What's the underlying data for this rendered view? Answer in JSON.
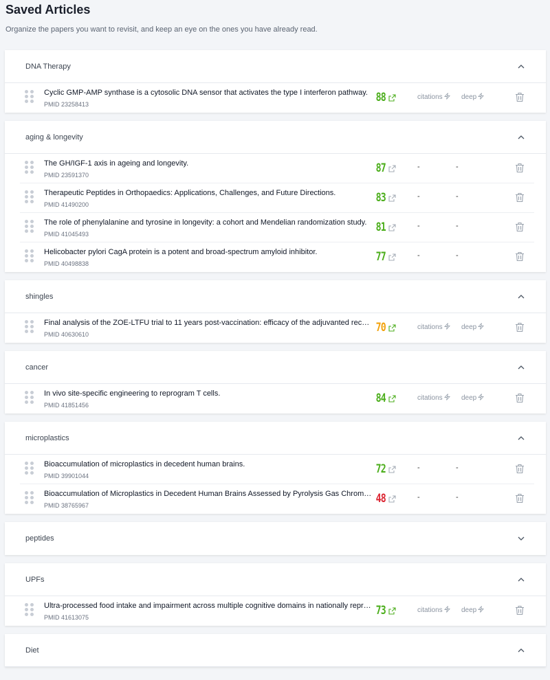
{
  "header": {
    "title": "Saved Articles",
    "subtitle": "Organize the papers you want to revisit, and keep an eye on the ones you have already read."
  },
  "colors": {
    "green": "#4cae1c",
    "orange": "#f2a20c",
    "red": "#dc2633"
  },
  "icons": {
    "drag": "drag-handle-icon",
    "external": "external-link-icon",
    "bolt": "bolt-icon",
    "trash": "trash-icon",
    "chevron": "chevron-icon"
  },
  "labels": {
    "citations": "citations",
    "deep": "deep",
    "dash": "-"
  },
  "folders": [
    {
      "name": "DNA Therapy",
      "expanded": true,
      "articles": [
        {
          "title": "Cyclic GMP-AMP synthase is a cytosolic DNA sensor that activates the type I interferon pathway.",
          "pmid": "PMID 23258413",
          "score": "88",
          "color": "green",
          "actions": true
        }
      ]
    },
    {
      "name": "aging & longevity",
      "expanded": true,
      "articles": [
        {
          "title": "The GH/IGF-1 axis in ageing and longevity.",
          "pmid": "PMID 23591370",
          "score": "87",
          "color": "green",
          "actions": false
        },
        {
          "title": "Therapeutic Peptides in Orthopaedics: Applications, Challenges, and Future Directions.",
          "pmid": "PMID 41490200",
          "score": "83",
          "color": "green",
          "actions": false
        },
        {
          "title": "The role of phenylalanine and tyrosine in longevity: a cohort and Mendelian randomization study.",
          "pmid": "PMID 41045493",
          "score": "81",
          "color": "green",
          "actions": false
        },
        {
          "title": "Helicobacter pylori CagA protein is a potent and broad-spectrum amyloid inhibitor.",
          "pmid": "PMID 40498838",
          "score": "77",
          "color": "green",
          "actions": false
        }
      ]
    },
    {
      "name": "shingles",
      "expanded": true,
      "articles": [
        {
          "title": "Final analysis of the ZOE-LTFU trial to 11 years post-vaccination: efficacy of the adjuvanted recomb…",
          "pmid": "PMID 40630610",
          "score": "70",
          "color": "orange",
          "actions": true
        }
      ]
    },
    {
      "name": "cancer",
      "expanded": true,
      "articles": [
        {
          "title": "In vivo site-specific engineering to reprogram T cells.",
          "pmid": "PMID 41851456",
          "score": "84",
          "color": "green",
          "actions": true
        }
      ]
    },
    {
      "name": "microplastics",
      "expanded": true,
      "articles": [
        {
          "title": "Bioaccumulation of microplastics in decedent human brains.",
          "pmid": "PMID 39901044",
          "score": "72",
          "color": "green",
          "actions": false
        },
        {
          "title": "Bioaccumulation of Microplastics in Decedent Human Brains Assessed by Pyrolysis Gas Chromat…",
          "pmid": "PMID 38765967",
          "score": "48",
          "color": "red",
          "actions": false
        }
      ]
    },
    {
      "name": "peptides",
      "expanded": false,
      "articles": []
    },
    {
      "name": "UPFs",
      "expanded": true,
      "articles": [
        {
          "title": "Ultra-processed food intake and impairment across multiple cognitive domains in nationally repre…",
          "pmid": "PMID 41613075",
          "score": "73",
          "color": "green",
          "actions": true
        }
      ]
    },
    {
      "name": "Diet",
      "expanded": true,
      "articles": []
    }
  ]
}
